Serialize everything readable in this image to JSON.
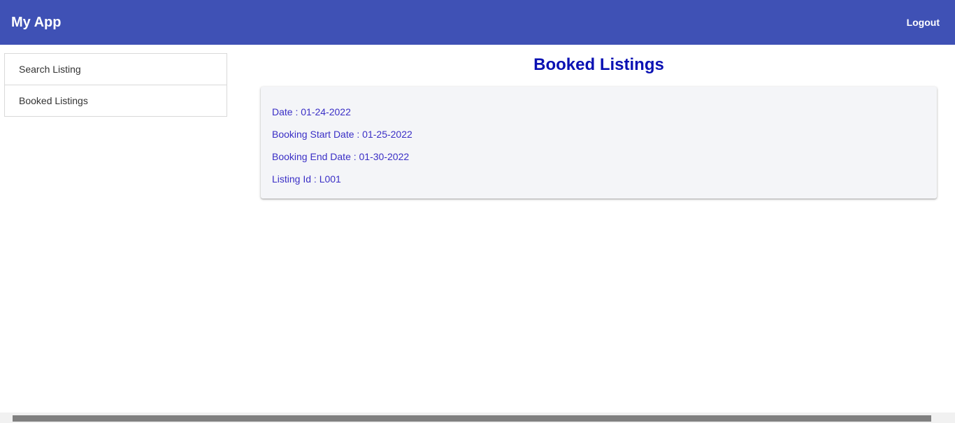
{
  "header": {
    "title": "My App",
    "logout_label": "Logout"
  },
  "sidebar": {
    "items": [
      {
        "label": "Search Listing"
      },
      {
        "label": "Booked Listings"
      }
    ]
  },
  "main": {
    "title": "Booked Listings",
    "booking": {
      "date": "Date : 01-24-2022",
      "start_date": "Booking Start Date : 01-25-2022",
      "end_date": "Booking End Date : 01-30-2022",
      "listing_id": "Listing Id : L001"
    }
  },
  "colors": {
    "app_bar": "#3f51b5",
    "title": "#0a11b3",
    "card_text": "#3a2fc6"
  }
}
